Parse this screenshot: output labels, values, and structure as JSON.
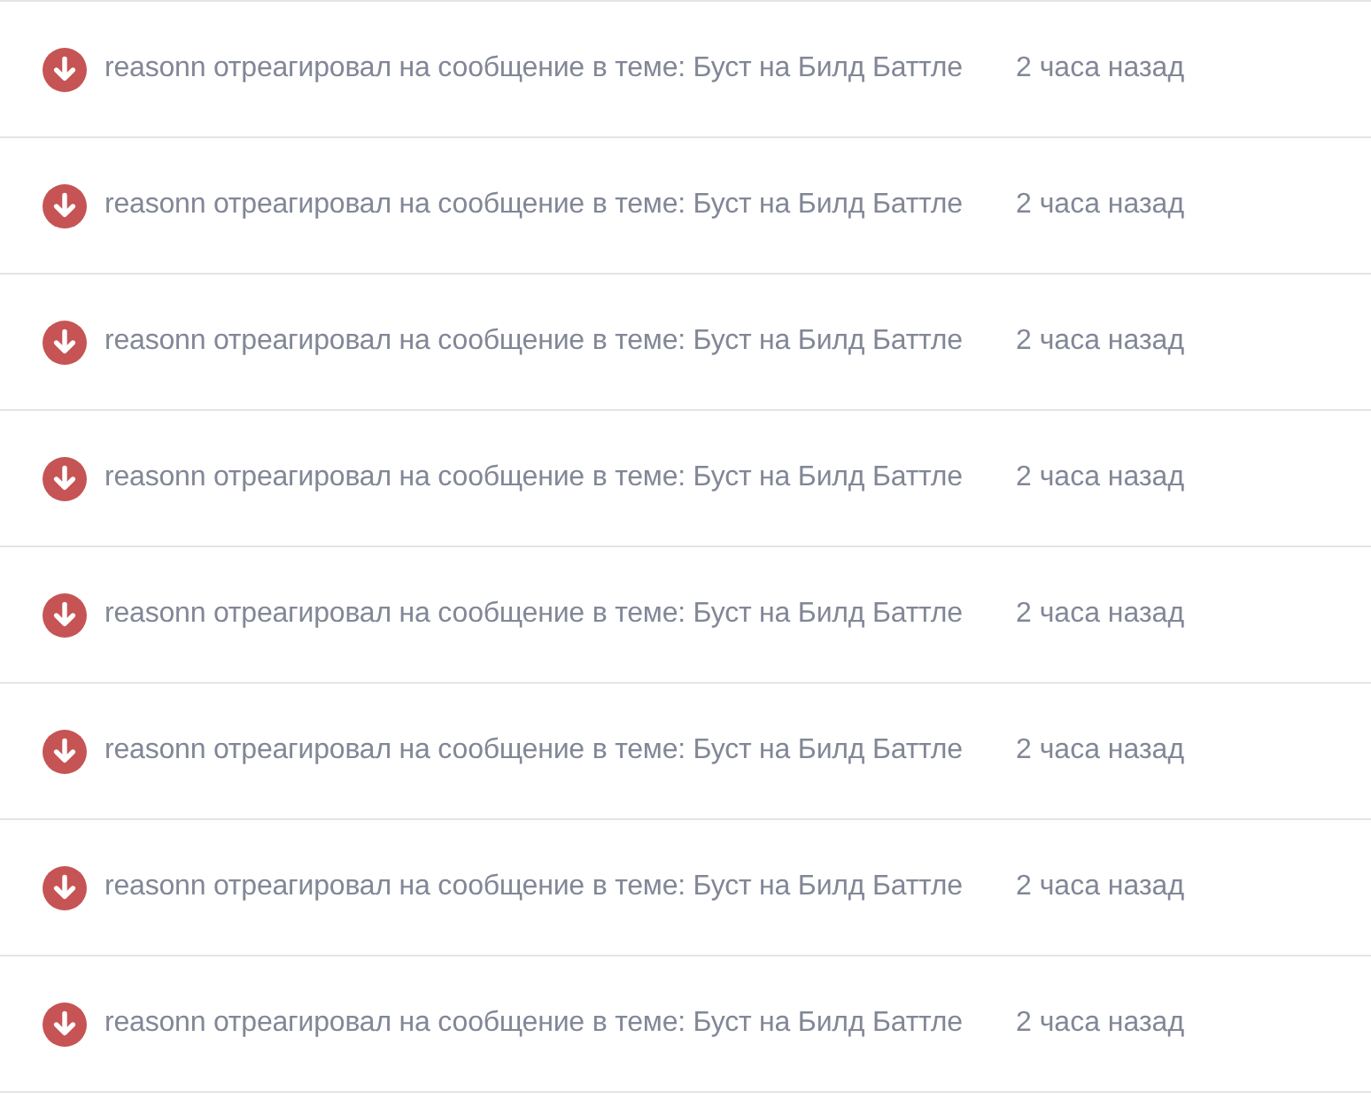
{
  "notifications": [
    {
      "message": "reasonn отреагировал на сообщение в теме: Буст на Билд Баттле",
      "time": "2 часа назад"
    },
    {
      "message": "reasonn отреагировал на сообщение в теме: Буст на Билд Баттле",
      "time": "2 часа назад"
    },
    {
      "message": "reasonn отреагировал на сообщение в теме: Буст на Билд Баттле",
      "time": "2 часа назад"
    },
    {
      "message": "reasonn отреагировал на сообщение в теме: Буст на Билд Баттле",
      "time": "2 часа назад"
    },
    {
      "message": "reasonn отреагировал на сообщение в теме: Буст на Билд Баттле",
      "time": "2 часа назад"
    },
    {
      "message": "reasonn отреагировал на сообщение в теме: Буст на Билд Баттле",
      "time": "2 часа назад"
    },
    {
      "message": "reasonn отреагировал на сообщение в теме: Буст на Билд Баттле",
      "time": "2 часа назад"
    },
    {
      "message": "reasonn отреагировал на сообщение в теме: Буст на Билд Баттле",
      "time": "2 часа назад"
    }
  ]
}
